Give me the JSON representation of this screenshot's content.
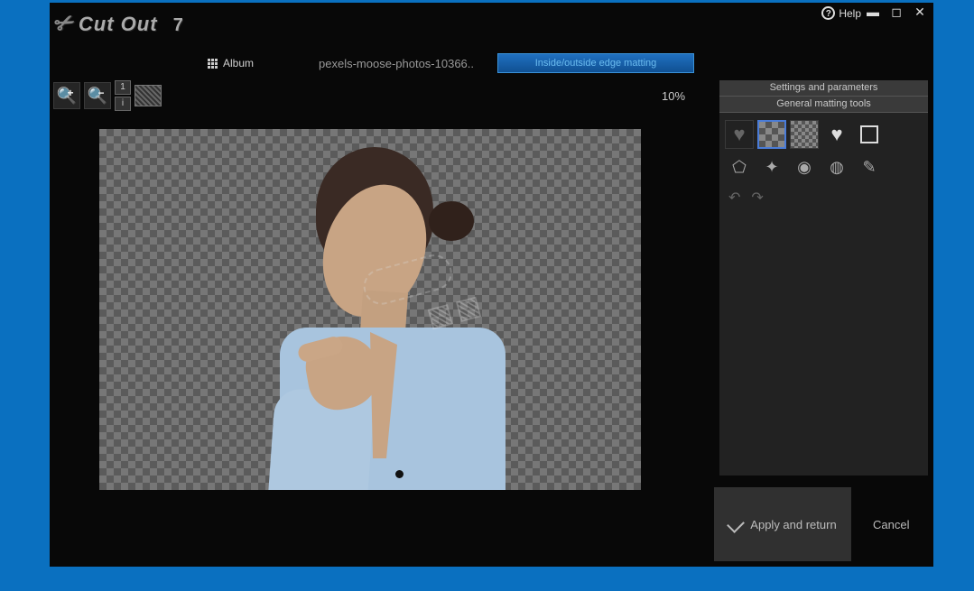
{
  "app": {
    "brand": "Cut Out",
    "version": "7",
    "help_label": "Help"
  },
  "header": {
    "album_label": "Album",
    "filename": "pexels-moose-photos-10366..",
    "mode_label": "Inside/outside edge matting"
  },
  "toolbar": {
    "zoom_pct": "10%"
  },
  "panels": {
    "settings_label": "Settings and parameters",
    "matting_label": "General matting tools"
  },
  "footer": {
    "apply_label": "Apply and return",
    "cancel_label": "Cancel"
  }
}
